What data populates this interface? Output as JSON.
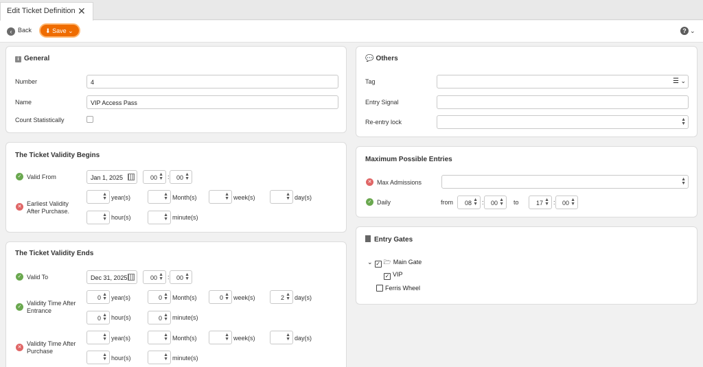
{
  "tab": {
    "title": "Edit Ticket Definition",
    "close": "✕"
  },
  "toolbar": {
    "back": "Back",
    "save": "Save"
  },
  "general": {
    "title": "General",
    "number_label": "Number",
    "number_value": "4",
    "name_label": "Name",
    "name_value": "VIP Access Pass",
    "count_label": "Count Statistically"
  },
  "begins": {
    "title": "The Ticket Validity Begins",
    "valid_from": "Valid From",
    "date": "Jan 1, 2025",
    "hh": "00",
    "mm": "00",
    "earliest_1": "Earliest Validity",
    "earliest_2": "After Purchase."
  },
  "ends": {
    "title": "The Ticket Validity Ends",
    "valid_to": "Valid To",
    "date": "Dec 31, 2025",
    "hh": "00",
    "mm": "00",
    "entrance_1": "Validity Time After",
    "entrance_2": "Entrance",
    "purchase_1": "Validity Time After",
    "purchase_2": "Purchase",
    "e_year": "0",
    "e_month": "0",
    "e_week": "0",
    "e_day": "2",
    "e_hour": "0",
    "e_minute": "0"
  },
  "units": {
    "year": "year(s)",
    "month": "Month(s)",
    "week": "week(s)",
    "day": "day(s)",
    "hour": "hour(s)",
    "minute": "minute(s)"
  },
  "others": {
    "title": "Others",
    "tag": "Tag",
    "entry_signal": "Entry Signal",
    "reentry": "Re-entry lock"
  },
  "max": {
    "title": "Maximum Possible Entries",
    "max_adm": "Max Admissions",
    "daily": "Daily",
    "from": "from",
    "to": "to",
    "from_h": "08",
    "from_m": "00",
    "to_h": "17",
    "to_m": "00"
  },
  "gates": {
    "title": "Entry Gates",
    "main": "Main Gate",
    "vip": "VIP",
    "ferris": "Ferris Wheel"
  }
}
